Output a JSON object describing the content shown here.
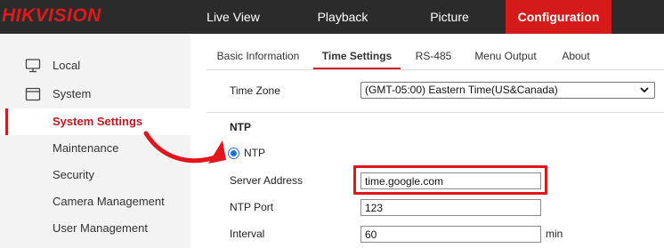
{
  "header": {
    "logo": "HIKVISION",
    "nav": [
      {
        "label": "Live View"
      },
      {
        "label": "Playback"
      },
      {
        "label": "Picture"
      },
      {
        "label": "Configuration",
        "active": true
      }
    ]
  },
  "sidebar": {
    "items": [
      {
        "label": "Local",
        "icon": "monitor-icon"
      },
      {
        "label": "System",
        "icon": "system-window-icon"
      }
    ],
    "sub_items": [
      {
        "label": "System Settings",
        "active": true
      },
      {
        "label": "Maintenance"
      },
      {
        "label": "Security"
      },
      {
        "label": "Camera Management"
      },
      {
        "label": "User Management"
      }
    ]
  },
  "tabs": [
    {
      "label": "Basic Information"
    },
    {
      "label": "Time Settings",
      "active": true
    },
    {
      "label": "RS-485"
    },
    {
      "label": "Menu Output"
    },
    {
      "label": "About"
    }
  ],
  "form": {
    "time_zone": {
      "label": "Time Zone",
      "value": "(GMT-05:00) Eastern Time(US&Canada)"
    },
    "ntp_section_title": "NTP",
    "ntp_radio": {
      "label": "NTP",
      "checked": true
    },
    "server_address": {
      "label": "Server Address",
      "value": "time.google.com"
    },
    "ntp_port": {
      "label": "NTP Port",
      "value": "123"
    },
    "interval": {
      "label": "Interval",
      "value": "60",
      "unit": "min"
    }
  },
  "colors": {
    "brand_red": "#d51a1a",
    "topbar_bg": "#2b2b2b",
    "sidebar_bg": "#f3f3f3",
    "radio_blue": "#1f6fe0",
    "highlight_red": "#e3141c"
  }
}
